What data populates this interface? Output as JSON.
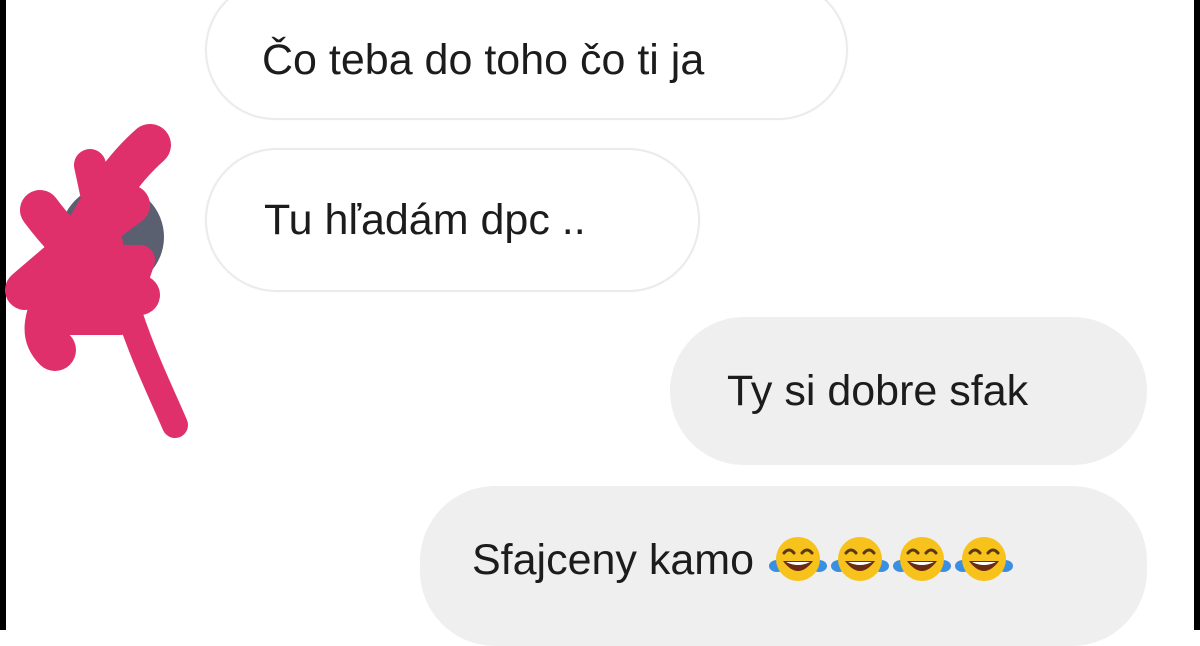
{
  "conversation": {
    "messages": [
      {
        "direction": "incoming",
        "text": "Čo teba do toho čo ti ja"
      },
      {
        "direction": "incoming",
        "text": "Tu hľadám dpc .."
      },
      {
        "direction": "outgoing",
        "text": "Ty si dobre sfak"
      },
      {
        "direction": "outgoing",
        "text": "Sfajceny kamo",
        "emoji": [
          "face-with-tears-of-joy",
          "face-with-tears-of-joy",
          "face-with-tears-of-joy",
          "face-with-tears-of-joy"
        ]
      }
    ]
  },
  "colors": {
    "incoming_bubble": "#ffffff",
    "incoming_border": "#ebebeb",
    "outgoing_bubble": "#efefef",
    "message_text": "#1c1c1c",
    "redaction_scribble": "#e0306c",
    "emoji_face": "#f7c21b",
    "emoji_tears": "#3b8fe0"
  },
  "icons": {
    "avatar": "sender-avatar",
    "emoji": "face-with-tears-of-joy",
    "redaction": "pink-scribble-redaction"
  }
}
